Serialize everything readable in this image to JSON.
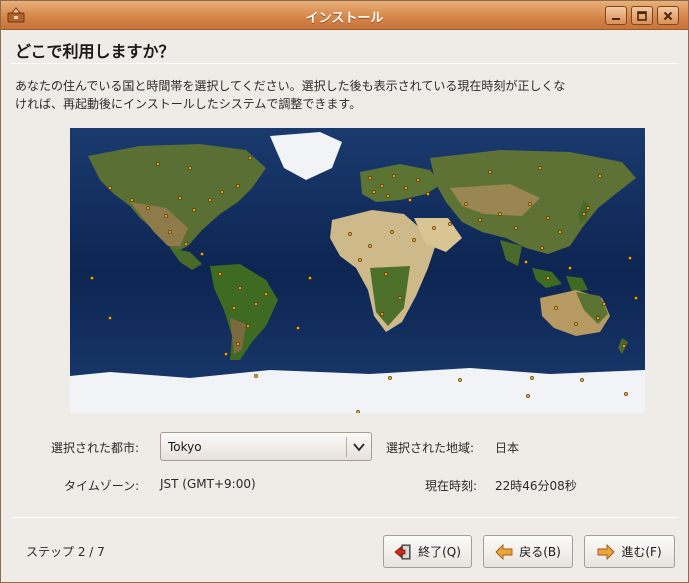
{
  "window": {
    "title": "インストール",
    "icon": "installer-icon",
    "controls": [
      "minimize-icon",
      "maximize-icon",
      "close-icon"
    ]
  },
  "page": {
    "heading": "どこで利用しますか？",
    "description_line1": "あなたの住んでいる国と時間帯を選択してください。選択した後も表示されている現在時刻が正しくな",
    "description_line2": "ければ、再起動後にインストールしたシステムで調整できます。"
  },
  "map": {
    "description": "world map with city markers"
  },
  "location": {
    "city_label": "選択された都市:",
    "city_value": "Tokyo",
    "region_label": "選択された地域:",
    "region_value": "日本",
    "timezone_label": "タイムゾーン:",
    "timezone_value": "JST (GMT+9:00)",
    "time_label": "現在時刻:",
    "time_value": "22時46分08秒"
  },
  "footer": {
    "step": "ステップ 2 / 7",
    "quit_label": "終了(Q)",
    "back_label": "戻る(B)",
    "next_label": "進む(F)"
  },
  "colors": {
    "titlebar": "#d6874a",
    "window_bg": "#efebe7",
    "ocean": "#0f2650",
    "land": "#4f6a2e",
    "desert": "#cdb98a",
    "ice": "#f4f6f8",
    "city_dot": "#f2a21c"
  }
}
